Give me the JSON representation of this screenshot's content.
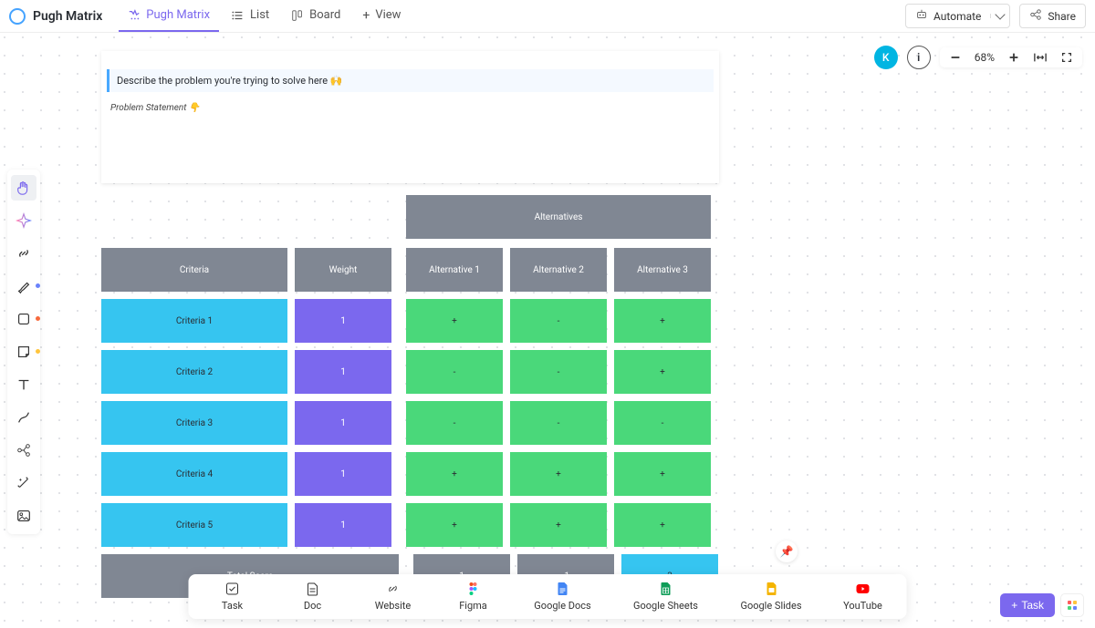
{
  "header": {
    "workspace_title": "Pugh Matrix",
    "tabs": [
      {
        "id": "whiteboard",
        "label": "Pugh Matrix",
        "active": true
      },
      {
        "id": "list",
        "label": "List",
        "active": false
      },
      {
        "id": "board",
        "label": "Board",
        "active": false
      }
    ],
    "add_view_label": "View",
    "automate_label": "Automate",
    "share_label": "Share"
  },
  "canvas": {
    "avatar_letter": "K",
    "zoom_label": "68%",
    "doc": {
      "callout": "Describe the problem you're trying to solve here 🙌",
      "subtitle": "Problem Statement 👇"
    }
  },
  "matrix": {
    "alternatives_header": "Alternatives",
    "columns": {
      "criteria": "Criteria",
      "weight": "Weight",
      "alt1": "Alternative 1",
      "alt2": "Alternative 2",
      "alt3": "Alternative 3"
    },
    "rows": [
      {
        "criteria": "Criteria 1",
        "weight": "1",
        "a1": "+",
        "a2": "-",
        "a3": "+"
      },
      {
        "criteria": "Criteria 2",
        "weight": "1",
        "a1": "-",
        "a2": "-",
        "a3": "+"
      },
      {
        "criteria": "Criteria 3",
        "weight": "1",
        "a1": "-",
        "a2": "-",
        "a3": "-"
      },
      {
        "criteria": "Criteria 4",
        "weight": "1",
        "a1": "+",
        "a2": "+",
        "a3": "+"
      },
      {
        "criteria": "Criteria 5",
        "weight": "1",
        "a1": "+",
        "a2": "+",
        "a3": "+"
      }
    ],
    "total": {
      "label": "Total Score",
      "a1": "1",
      "a2": "-1",
      "a3": "3"
    }
  },
  "dock": {
    "items": [
      {
        "id": "task",
        "label": "Task"
      },
      {
        "id": "doc",
        "label": "Doc"
      },
      {
        "id": "website",
        "label": "Website"
      },
      {
        "id": "figma",
        "label": "Figma"
      },
      {
        "id": "gdocs",
        "label": "Google Docs"
      },
      {
        "id": "gsheets",
        "label": "Google Sheets"
      },
      {
        "id": "gslides",
        "label": "Google Slides"
      },
      {
        "id": "youtube",
        "label": "YouTube"
      }
    ]
  },
  "fab": {
    "label": "Task"
  }
}
